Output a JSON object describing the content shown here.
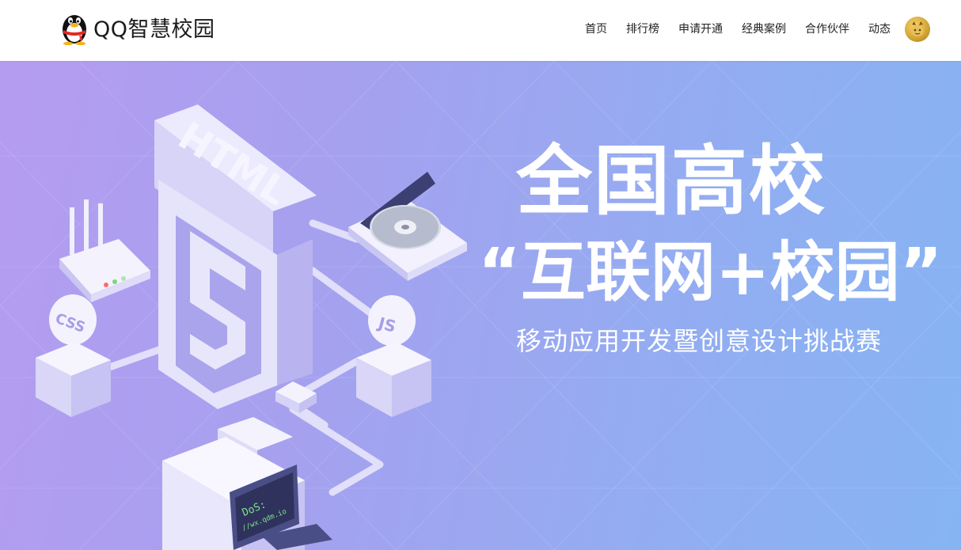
{
  "header": {
    "logo_text": "QQ智慧校园",
    "logo_icon": "qq-penguin-icon",
    "nav": [
      {
        "label": "首页"
      },
      {
        "label": "排行榜"
      },
      {
        "label": "申请开通"
      },
      {
        "label": "经典案例"
      },
      {
        "label": "合作伙伴"
      },
      {
        "label": "动态"
      }
    ],
    "avatar_icon": "user-avatar-icon"
  },
  "banner": {
    "title": "全国高校",
    "subtitle": "“互联网+校园”",
    "tagline": "移动应用开发暨创意设计挑战赛",
    "illustration_labels": {
      "html": "HTML",
      "css": "CSS",
      "js": "JS",
      "terminal_line1": "DoS:",
      "terminal_line2": "//wx.qdm.io"
    },
    "colors": {
      "gradient_start": "#b59cf0",
      "gradient_end": "#86b4f3",
      "text": "#ffffff"
    }
  }
}
